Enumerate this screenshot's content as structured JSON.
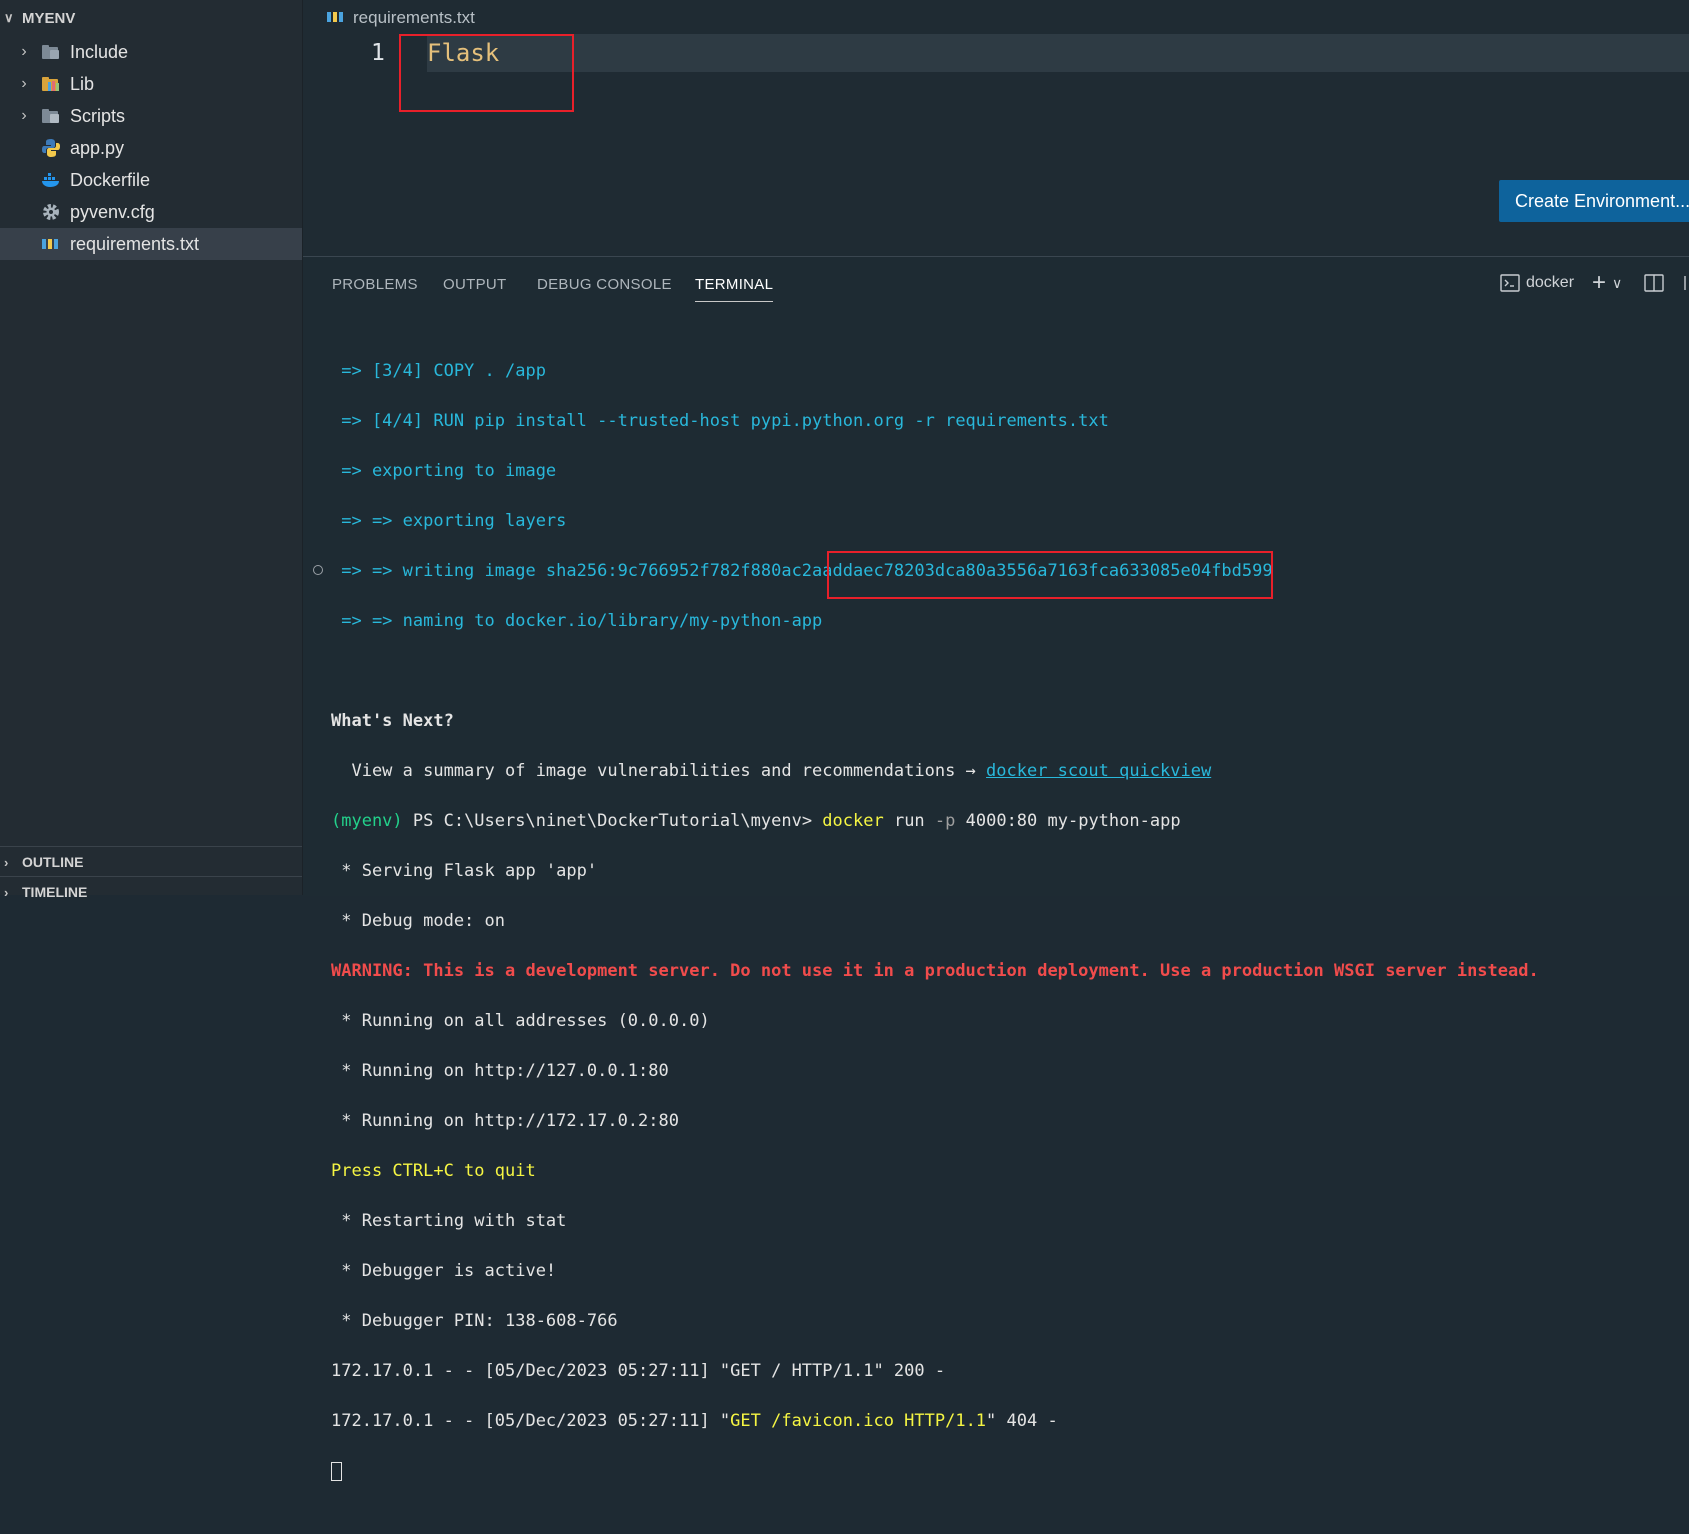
{
  "explorer": {
    "root_label": "MYENV",
    "items": [
      {
        "label": "Include",
        "type": "folder",
        "icon": "folder-include-icon"
      },
      {
        "label": "Lib",
        "type": "folder",
        "icon": "folder-lib-icon"
      },
      {
        "label": "Scripts",
        "type": "folder",
        "icon": "folder-scripts-icon"
      },
      {
        "label": "app.py",
        "type": "file",
        "icon": "python-icon"
      },
      {
        "label": "Dockerfile",
        "type": "file",
        "icon": "docker-icon"
      },
      {
        "label": "pyvenv.cfg",
        "type": "file",
        "icon": "gear-icon"
      },
      {
        "label": "requirements.txt",
        "type": "file",
        "icon": "pip-icon",
        "selected": true
      }
    ],
    "outline_label": "OUTLINE",
    "timeline_label": "TIMELINE"
  },
  "editor": {
    "tab_title": "requirements.txt",
    "line_number": "1",
    "code_line": "Flask",
    "create_env_button": "Create Environment..."
  },
  "panel": {
    "tabs": [
      "PROBLEMS",
      "OUTPUT",
      "DEBUG CONSOLE",
      "TERMINAL"
    ],
    "active_tab": "TERMINAL",
    "terminal_name": "docker"
  },
  "terminal": {
    "l1": " => [3/4] COPY . /app",
    "l2": " => [4/4] RUN pip install --trusted-host pypi.python.org -r requirements.txt",
    "l3": " => exporting to image",
    "l4": " => => exporting layers",
    "l5": " => => writing image sha256:9c766952f782f880ac2aaddaec78203dca80a3556a7163fca633085e04fbd599",
    "l6": " => => naming to docker.io/library/my-python-app",
    "l8": "What's Next?",
    "l9a": "  View a summary of image vulnerabilities and recommendations → ",
    "l9b": "docker scout quickview",
    "prompt_env": "(myenv)",
    "prompt_path": " PS C:\\Users\\ninet\\DockerTutorial\\myenv> ",
    "cmd_docker": "docker",
    "cmd_run": " run ",
    "cmd_flag": "-p",
    "cmd_rest": " 4000:80 my-python-app",
    "l11": " * Serving Flask app 'app'",
    "l12": " * Debug mode: on",
    "l13": "WARNING: This is a development server. Do not use it in a production deployment. Use a production WSGI server instead.",
    "l14": " * Running on all addresses (0.0.0.0)",
    "l15": " * Running on http://127.0.0.1:80",
    "l16": " * Running on http://172.17.0.2:80",
    "l17": "Press CTRL+C to quit",
    "l18": " * Restarting with stat",
    "l19": " * Debugger is active!",
    "l20": " * Debugger PIN: 138-608-766",
    "l21": "172.17.0.1 - - [05/Dec/2023 05:27:11] \"GET / HTTP/1.1\" 200 -",
    "l22a": "172.17.0.1 - - [05/Dec/2023 05:27:11] \"",
    "l22b": "GET /favicon.ico HTTP/1.1",
    "l22c": "\" 404 -"
  }
}
